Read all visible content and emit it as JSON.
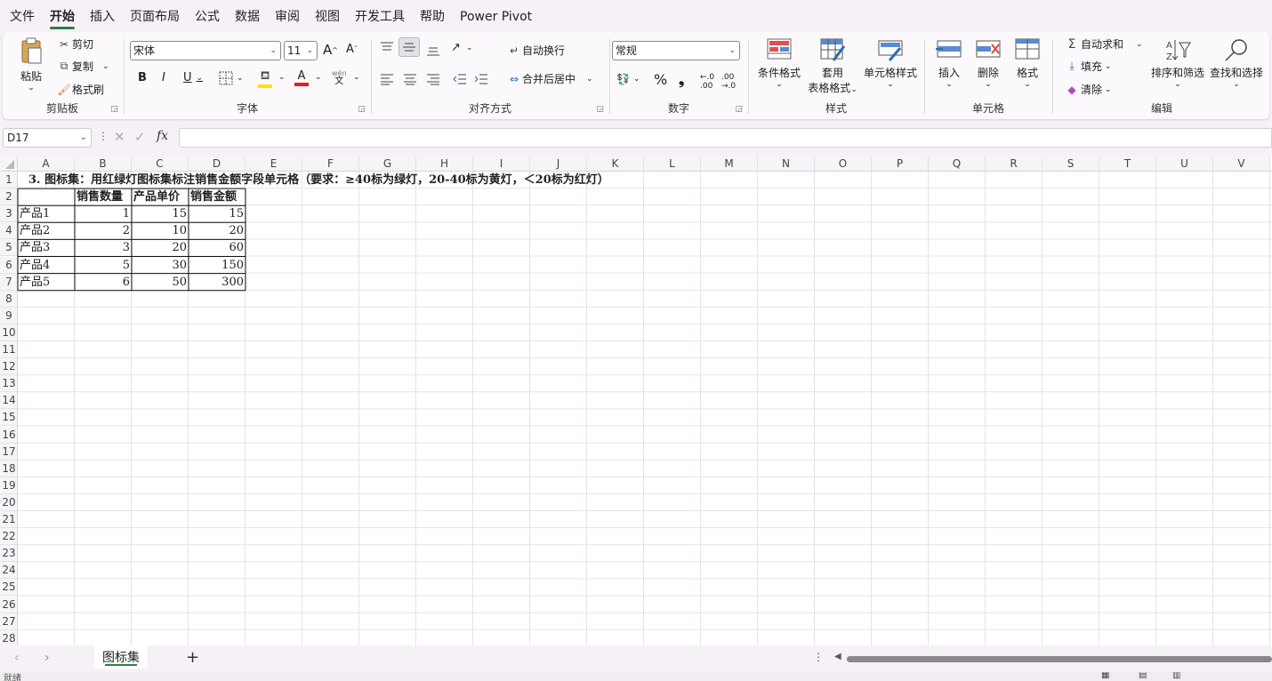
{
  "menu": [
    "文件",
    "开始",
    "插入",
    "页面布局",
    "公式",
    "数据",
    "审阅",
    "视图",
    "开发工具",
    "帮助",
    "Power Pivot"
  ],
  "menu_active": "开始",
  "ribbon": {
    "clipboard": {
      "paste": "粘贴",
      "cut": "剪切",
      "copy": "复制",
      "format_painter": "格式刷",
      "label": "剪贴板"
    },
    "font": {
      "name": "宋体",
      "size": "11",
      "label": "字体",
      "bold": "B",
      "italic": "I",
      "underline": "U",
      "grow": "A",
      "shrink": "A",
      "phonetic_top": "wén",
      "phonetic_bottom": "文",
      "font_color": "A"
    },
    "alignment": {
      "wrap": "自动换行",
      "merge": "合并后居中",
      "label": "对齐方式"
    },
    "number": {
      "format": "常规",
      "label": "数字",
      "percent": "%",
      "comma": "❟"
    },
    "styles": {
      "conditional": "条件格式",
      "table_line1": "套用",
      "table_line2": "表格格式",
      "cell_styles": "单元格样式",
      "label": "样式"
    },
    "cells": {
      "insert": "插入",
      "delete": "删除",
      "format": "格式",
      "label": "单元格"
    },
    "editing": {
      "autosum": "自动求和",
      "fill": "填充",
      "clear": "清除",
      "sort": "排序和筛选",
      "find": "查找和选择",
      "label": "编辑"
    }
  },
  "formula_bar": {
    "namebox": "D17",
    "fx": "fx",
    "value": ""
  },
  "columns": [
    "A",
    "B",
    "C",
    "D",
    "E",
    "F",
    "G",
    "H",
    "I",
    "J",
    "K",
    "L",
    "M",
    "N",
    "O",
    "P",
    "Q",
    "R",
    "S",
    "T",
    "U",
    "V"
  ],
  "rows": [
    "1",
    "2",
    "3",
    "4",
    "5",
    "6",
    "7",
    "8",
    "9",
    "10",
    "11",
    "12",
    "13",
    "14",
    "15",
    "16",
    "17",
    "18",
    "19",
    "20",
    "21",
    "22",
    "23",
    "24",
    "25",
    "26",
    "27",
    "28"
  ],
  "sheet": {
    "title": "3. 图标集：用红绿灯图标集标注销售金额字段单元格（要求：≥40标为绿灯，20-40标为黄灯，＜20标为红灯）",
    "headers": [
      "",
      "销售数量",
      "产品单价",
      "销售金额"
    ],
    "data": [
      [
        "产品1",
        "1",
        "15",
        "15"
      ],
      [
        "产品2",
        "2",
        "10",
        "20"
      ],
      [
        "产品3",
        "3",
        "20",
        "60"
      ],
      [
        "产品4",
        "5",
        "30",
        "150"
      ],
      [
        "产品5",
        "6",
        "50",
        "300"
      ]
    ]
  },
  "tabs": {
    "active": "图标集",
    "add": "+"
  },
  "status": {
    "left": "就绪"
  },
  "colors": {
    "accent": "#2e7d4a",
    "font_color_bar": "#e02020",
    "fill_color_bar": "#ffe000"
  }
}
